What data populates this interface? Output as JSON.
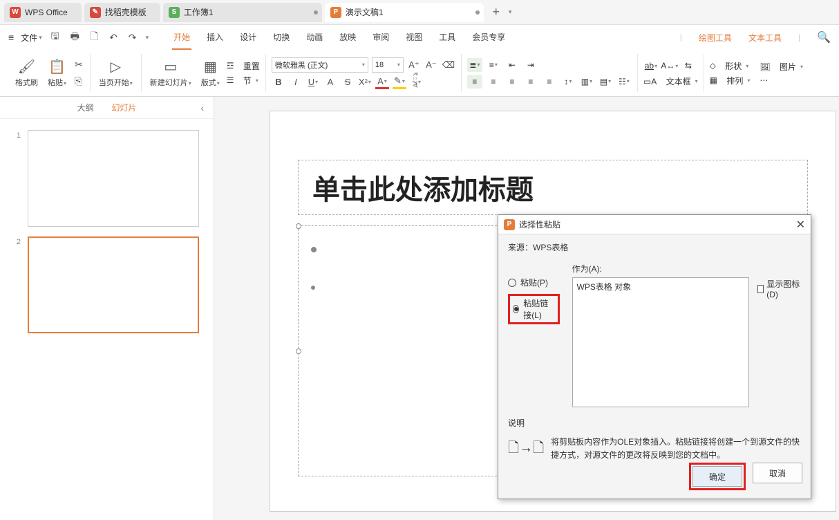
{
  "tabs": {
    "wps": "WPS Office",
    "template": "找稻壳模板",
    "workbook": "工作簿1",
    "presentation": "演示文稿1"
  },
  "menu": {
    "file": "文件",
    "items": [
      "开始",
      "插入",
      "设计",
      "切换",
      "动画",
      "放映",
      "审阅",
      "视图",
      "工具",
      "会员专享"
    ],
    "right": {
      "drawing": "绘图工具",
      "text": "文本工具"
    }
  },
  "ribbon": {
    "format_painter": "格式刷",
    "paste": "粘贴",
    "current_page": "当页开始",
    "new_slide": "新建幻灯片",
    "layout": "版式",
    "reset": "重置",
    "section": "节",
    "font_name": "微软雅黑 (正文)",
    "font_size": "18",
    "shape": "形状",
    "picture": "图片",
    "textbox": "文本框",
    "arrange": "排列"
  },
  "side": {
    "outline": "大纲",
    "slides": "幻灯片"
  },
  "slide": {
    "title_placeholder": "单击此处添加标题"
  },
  "dialog": {
    "title": "选择性粘贴",
    "source_label": "来源：",
    "source_value": "WPS表格",
    "paste": "粘贴(P)",
    "paste_link": "粘贴链接(L)",
    "as_label": "作为(A):",
    "list_item": "WPS表格 对象",
    "show_icon": "显示图标(D)",
    "desc_label": "说明",
    "desc_text": "将剪贴板内容作为OLE对象插入。粘贴链接将创建一个到源文件的快捷方式，对源文件的更改将反映到您的文档中。",
    "ok": "确定",
    "cancel": "取消"
  }
}
